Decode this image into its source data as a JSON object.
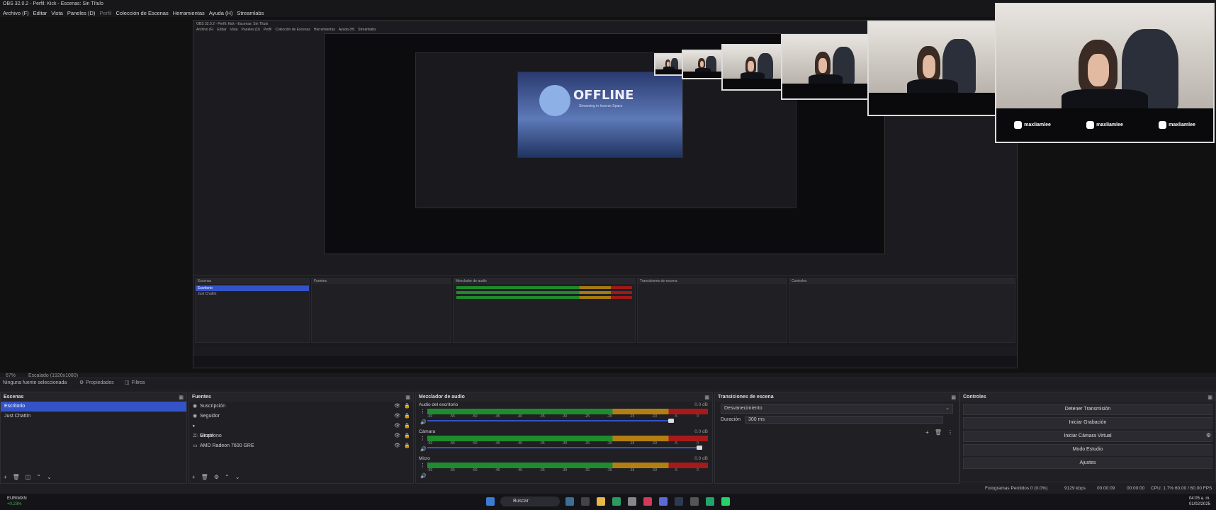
{
  "app": {
    "title": "OBS 32.0.2 - Perfil: Kick - Escenas: Sin Título",
    "menus": [
      "Archivo (F)",
      "Editar",
      "Vista",
      "Paneles (D)",
      "Perfil",
      "Colección de Escenas",
      "Herramientas",
      "Ayuda (H)",
      "Streamlabs"
    ]
  },
  "preview": {
    "offline_word": "OFFLINE",
    "offline_sub": "Streaming in Inverse Space",
    "nested_title": "OBS 32.0.2 - Perfil: Kick - Escenas: Sin Título",
    "nested_menus": [
      "Archivo (F)",
      "Editar",
      "Vista",
      "Paneles (D)",
      "Perfil",
      "Colección de Escenas",
      "Herramientas",
      "Ayuda (H)",
      "Streamlabs"
    ],
    "webcam_socials": [
      {
        "icon": "instagram-icon",
        "glyph": "◎",
        "handle": "maxliamlee"
      },
      {
        "icon": "tiktok-icon",
        "glyph": "♪",
        "handle": "maxliamlee"
      },
      {
        "icon": "youtube-icon",
        "glyph": "▶",
        "handle": "maxliamlee"
      }
    ]
  },
  "zoom_bar": {
    "zoom": "67%",
    "scale": "Escalado (1920x1080)"
  },
  "source_bar": {
    "no_source": "Ninguna fuente seleccionada",
    "properties": "Propiedades",
    "filters": "Filtros"
  },
  "scenes": {
    "header": "Escenas",
    "items": [
      "Escritorio",
      "Just Chattin"
    ],
    "selected": 0
  },
  "sources": {
    "header": "Fuentes",
    "items": [
      {
        "label": "Suscripción",
        "icon": "chat-icon",
        "glyph": "◉"
      },
      {
        "label": "Seguidor",
        "icon": "chat-icon",
        "glyph": "◉"
      },
      {
        "label": "Grupo",
        "icon": "folder-icon",
        "glyph": "▸ 🗀"
      },
      {
        "label": "Micrófono",
        "icon": "mic-icon",
        "glyph": "♫"
      },
      {
        "label": "AMD Radeon 7600 GRE",
        "icon": "monitor-icon",
        "glyph": "▭"
      }
    ]
  },
  "mixer": {
    "header": "Mezclador de audio",
    "channels": [
      {
        "name": "Audio del escritorio",
        "db": "0.0 dB",
        "volume": 0.88
      },
      {
        "name": "Cámara",
        "db": "0.0 dB",
        "volume": 0.98
      },
      {
        "name": "Micro",
        "db": "0.0 dB",
        "volume": 0
      }
    ],
    "ticks": [
      "-60",
      "-55",
      "-50",
      "-45",
      "-40",
      "-35",
      "-30",
      "-25",
      "-20",
      "-15",
      "-10",
      "-5",
      "0"
    ]
  },
  "transitions": {
    "header": "Transiciones de escena",
    "selected": "Desvanecimiento",
    "duration_label": "Duración",
    "duration_value": "300 ms"
  },
  "controls": {
    "header": "Controles",
    "buttons": [
      "Detener Transmisión",
      "Iniciar Grabación",
      "Iniciar Cámara Virtual",
      "Modo Estudio",
      "Ajustes"
    ]
  },
  "status": {
    "dropped": "Fotogramas Perdidos 0 (0.0%)",
    "bitrate": "9129 kbps",
    "stream_time": "00:00:09",
    "rec_time": "00:00:00",
    "cpu": "CPU: 1.7%",
    "fps": "60.00 / 60.00 FPS"
  },
  "taskbar": {
    "weather_name": "EUR/MXN",
    "weather_value": "+0.23%",
    "search": "Buscar",
    "time": "04:05 a. m.",
    "date": "01/02/2025"
  },
  "colors": {
    "accent": "#3553c8",
    "meter_green": "#1f8c2e",
    "meter_yellow": "#b47f12",
    "meter_red": "#a8191a"
  }
}
